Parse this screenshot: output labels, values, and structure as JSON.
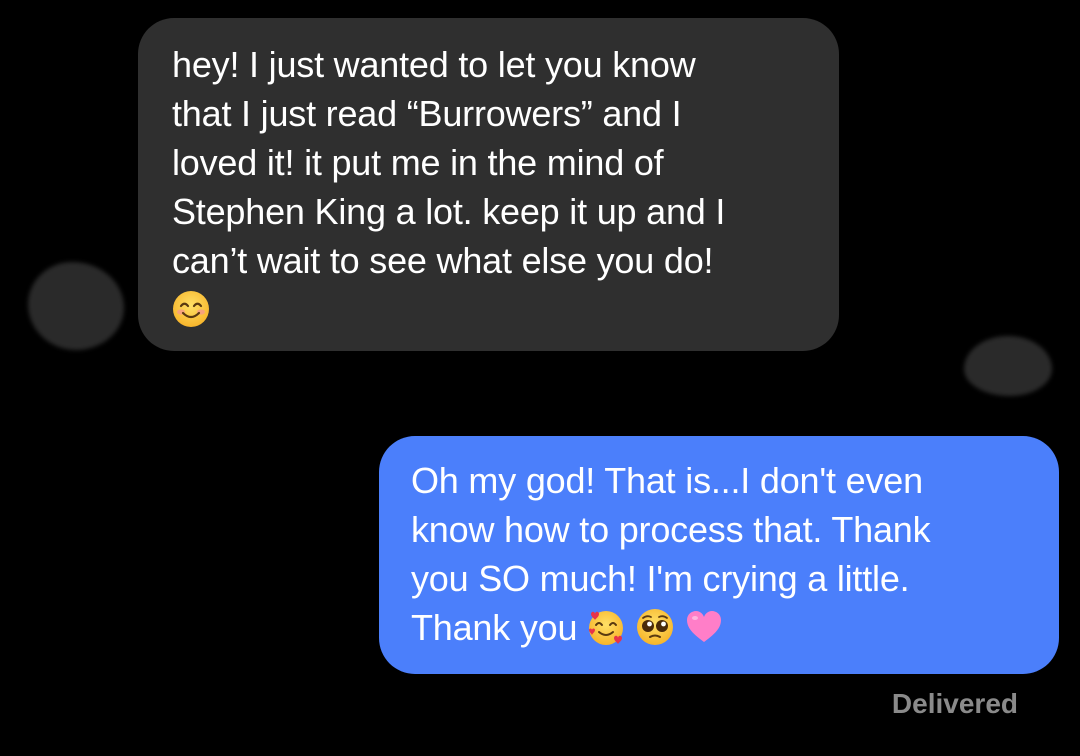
{
  "conversation": {
    "received_message": {
      "lines": [
        "hey! I just wanted to let you know",
        "that I just read “Burrowers” and I",
        "loved it! it put me in the mind of",
        "Stephen King a lot. keep it up and I",
        "can’t wait to see what else you do!"
      ],
      "emojis": [
        "smiling-face-with-smiling-eyes"
      ]
    },
    "sent_message": {
      "lines": [
        "Oh my god! That is...I don't even",
        "know how to process that. Thank",
        "you SO much! I'm crying a little.",
        "Thank you"
      ],
      "emojis": [
        "smiling-face-with-hearts",
        "pleading-face",
        "pink-heart"
      ]
    },
    "status": "Delivered"
  },
  "colors": {
    "background": "#000000",
    "received_bubble": "#2f2f2f",
    "sent_bubble": "#4b7ffb",
    "status_text": "#8a8a8a"
  }
}
